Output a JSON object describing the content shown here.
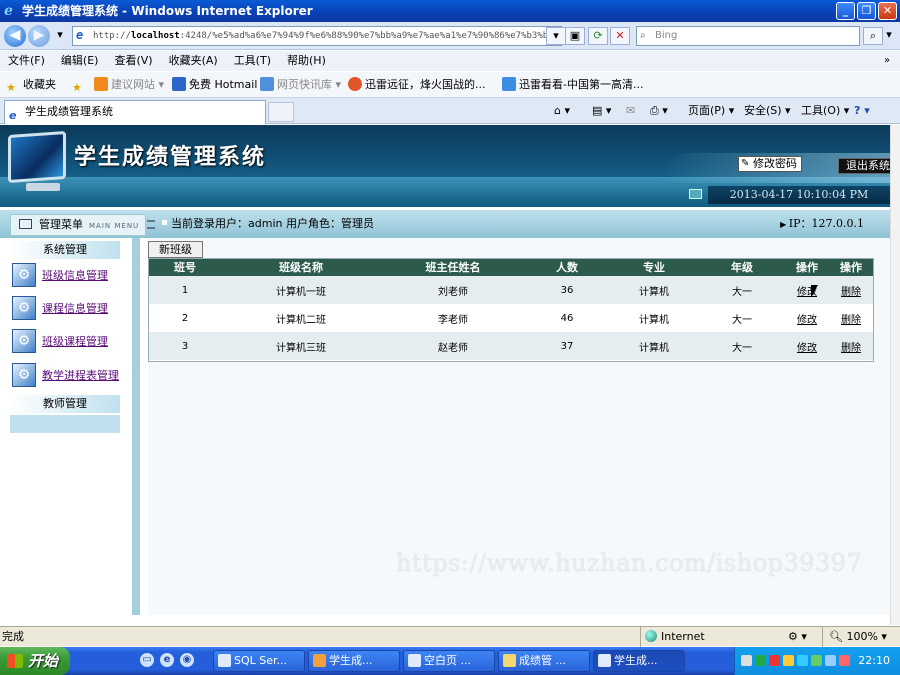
{
  "window": {
    "title": "学生成绩管理系统 - Windows Internet Explorer",
    "url_prefix": "http://",
    "url_host": "localhost",
    "url_rest": ":4248/%e5%ad%a6%e7%94%9f%e6%88%90%e7%bb%a9%e7%ae%a1%e7%90%86%e7%b3%bb",
    "search_placeholder": "Bing"
  },
  "menubar": [
    "文件(F)",
    "编辑(E)",
    "查看(V)",
    "收藏夹(A)",
    "工具(T)",
    "帮助(H)"
  ],
  "favorites": {
    "label": "收藏夹",
    "items": [
      "建议网站 ▾",
      "免费 Hotmail",
      "网页快讯库 ▾",
      "迅雷远征，烽火国战的...",
      "迅雷看看-中国第一高清..."
    ]
  },
  "tab": {
    "title": "学生成绩管理系统"
  },
  "commandbar": {
    "page": "页面(P) ▾",
    "safety": "安全(S) ▾",
    "tools": "工具(O) ▾",
    "help": "? ▾"
  },
  "header": {
    "app_title": "学生成绩管理系统",
    "change_password": "修改密码",
    "logout": "退出系统",
    "datetime": "2013-04-17 10:10:04 PM"
  },
  "userbar": {
    "menu_title": "管理菜单",
    "menu_subtitle": "MAIN MENU",
    "current_user": "当前登录用户：admin  用户角色：管理员",
    "ip": "IP：127.0.0.1"
  },
  "sidebar": {
    "sections": [
      {
        "title": "系统管理",
        "items": [
          "班级信息管理",
          "课程信息管理",
          "班级课程管理",
          "教学进程表管理"
        ]
      },
      {
        "title": "教师管理",
        "items": []
      }
    ]
  },
  "content": {
    "new_button": "新班级",
    "columns": [
      "班号",
      "班级名称",
      "班主任姓名",
      "人数",
      "专业",
      "年级",
      "操作",
      "操作"
    ],
    "rows": [
      [
        "1",
        "计算机一班",
        "刘老师",
        "36",
        "计算机",
        "大一",
        "修改",
        "删除"
      ],
      [
        "2",
        "计算机二班",
        "李老师",
        "46",
        "计算机",
        "大一",
        "修改",
        "删除"
      ],
      [
        "3",
        "计算机三班",
        "赵老师",
        "37",
        "计算机",
        "大一",
        "修改",
        "删除"
      ]
    ]
  },
  "watermark": "https://www.huzhan.com/ishop39397",
  "statusbar": {
    "status": "完成",
    "zone": "Internet",
    "zoom": "100%"
  },
  "taskbar": {
    "start": "开始",
    "tasks": [
      "SQL Ser...",
      "学生成...",
      "空白页 ...",
      "成绩管 ...",
      "学生成..."
    ],
    "clock": "22:10"
  }
}
